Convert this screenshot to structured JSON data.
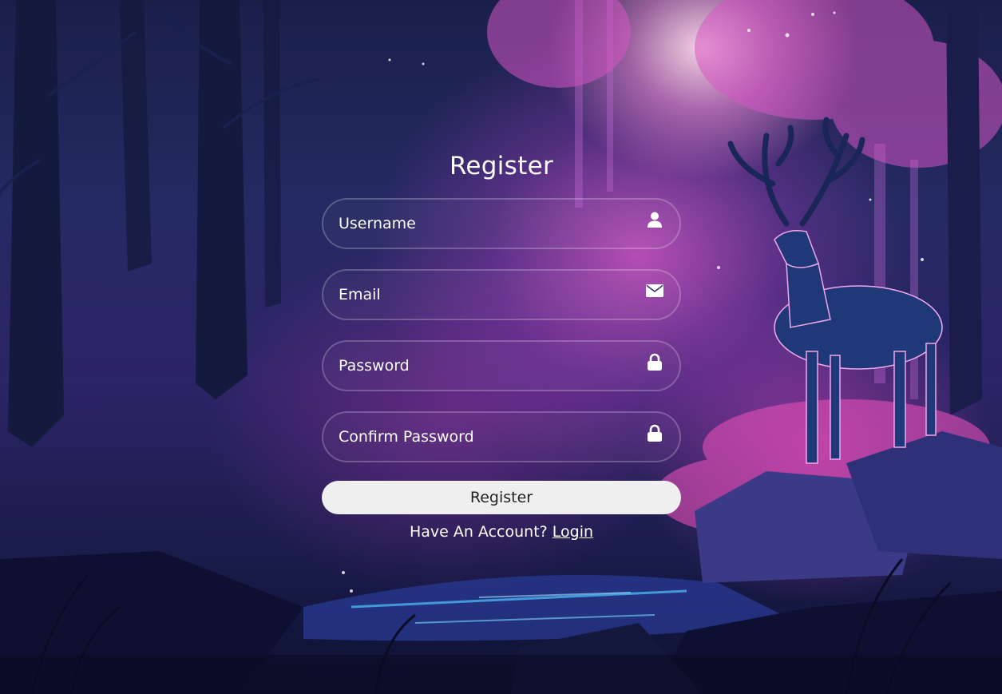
{
  "form": {
    "title": "Register",
    "fields": [
      {
        "placeholder": "Username",
        "icon": "user-icon"
      },
      {
        "placeholder": "Email",
        "icon": "envelope-icon"
      },
      {
        "placeholder": "Password",
        "icon": "lock-icon"
      },
      {
        "placeholder": "Confirm Password",
        "icon": "lock-icon"
      }
    ],
    "submit_label": "Register",
    "have_account_text": "Have An Account?",
    "login_link": "Login"
  },
  "colors": {
    "accent_pink": "#e05ad2",
    "deep_blue": "#1b1d4d",
    "button_bg": "#efefef"
  }
}
